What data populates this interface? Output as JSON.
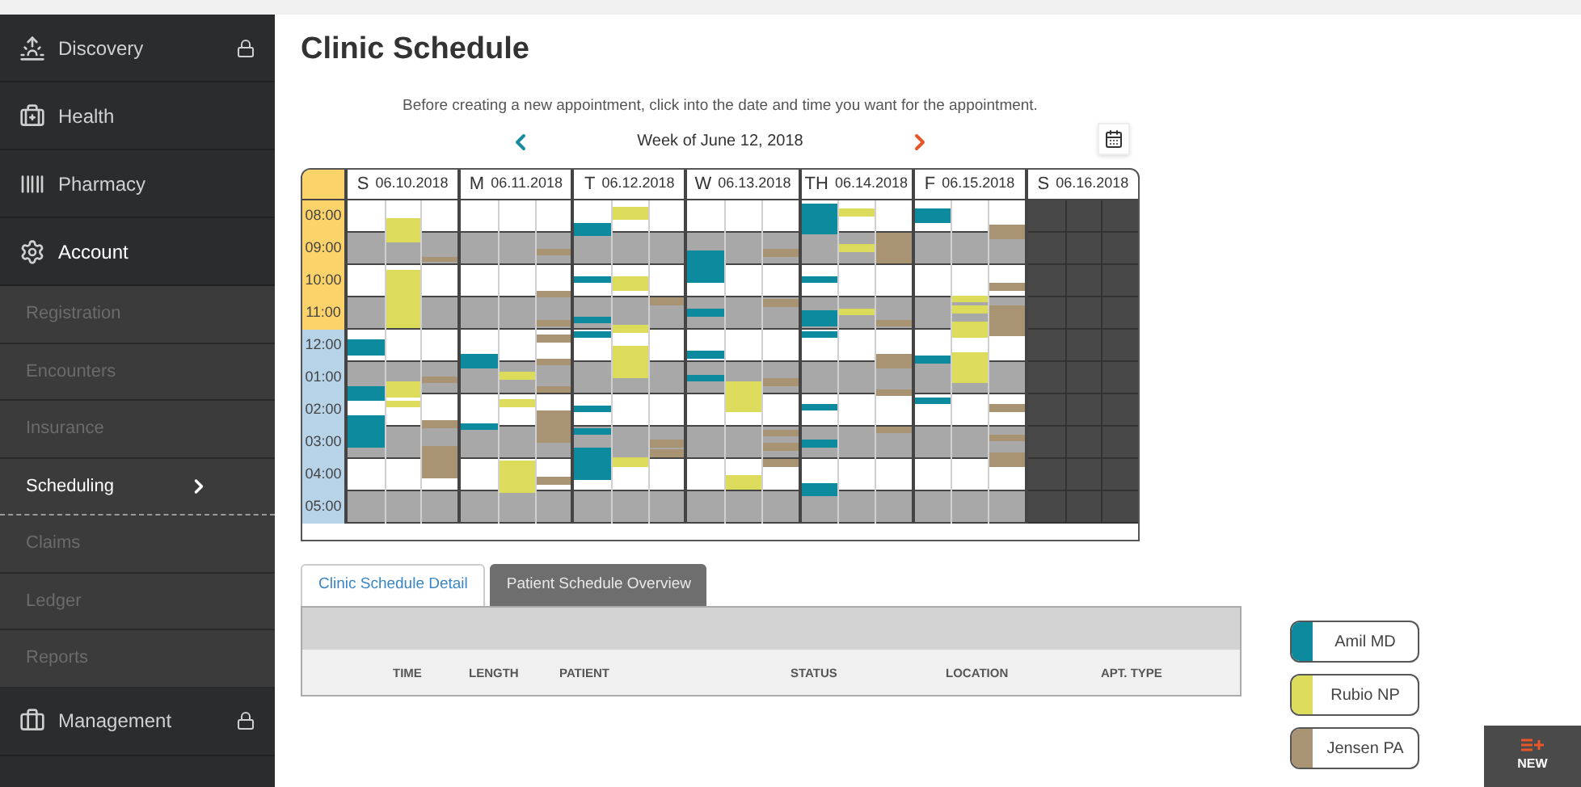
{
  "sidebar": {
    "items": [
      {
        "label": "Discovery",
        "locked": true,
        "expanded": false
      },
      {
        "label": "Health",
        "locked": false,
        "expanded": false
      },
      {
        "label": "Pharmacy",
        "locked": false,
        "expanded": false
      },
      {
        "label": "Account",
        "locked": false,
        "expanded": true,
        "children": [
          {
            "label": "Registration",
            "selected": false
          },
          {
            "label": "Encounters",
            "selected": false
          },
          {
            "label": "Insurance",
            "selected": false
          },
          {
            "label": "Scheduling",
            "selected": true
          },
          {
            "label": "Claims",
            "selected": false
          },
          {
            "label": "Ledger",
            "selected": false
          },
          {
            "label": "Reports",
            "selected": false
          }
        ]
      },
      {
        "label": "Management",
        "locked": true,
        "expanded": false
      }
    ]
  },
  "page": {
    "title": "Clinic Schedule",
    "instruction": "Before creating a new appointment, click into the date and time you want for the appointment.",
    "week": "Week of June 12, 2018"
  },
  "times": [
    {
      "label": "08:00",
      "color": "#fcd36b"
    },
    {
      "label": "09:00",
      "color": "#fcd36b"
    },
    {
      "label": "10:00",
      "color": "#fcd36b"
    },
    {
      "label": "11:00",
      "color": "#fcd36b"
    },
    {
      "label": "12:00",
      "color": "#b7d3e8"
    },
    {
      "label": "01:00",
      "color": "#b7d3e8"
    },
    {
      "label": "02:00",
      "color": "#b7d3e8"
    },
    {
      "label": "03:00",
      "color": "#b7d3e8"
    },
    {
      "label": "04:00",
      "color": "#b7d3e8"
    },
    {
      "label": "05:00",
      "color": "#b7d3e8"
    }
  ],
  "days": [
    {
      "letter": "S",
      "date": "06.10.2018",
      "closed": false
    },
    {
      "letter": "M",
      "date": "06.11.2018",
      "closed": false
    },
    {
      "letter": "T",
      "date": "06.12.2018",
      "closed": false
    },
    {
      "letter": "W",
      "date": "06.13.2018",
      "closed": false
    },
    {
      "letter": "TH",
      "date": "06.14.2018",
      "closed": false
    },
    {
      "letter": "F",
      "date": "06.15.2018",
      "closed": false
    },
    {
      "letter": "S",
      "date": "06.16.2018",
      "closed": true
    }
  ],
  "detail": {
    "tabs": [
      {
        "label": "Clinic Schedule Detail",
        "selected": true
      },
      {
        "label": "Patient Schedule Overview",
        "selected": false
      }
    ],
    "columns": [
      "TIME",
      "LENGTH",
      "PATIENT",
      "STATUS",
      "LOCATION",
      "APT. TYPE"
    ]
  },
  "legend": [
    {
      "label": "Amil MD",
      "color": "#0e8a9e"
    },
    {
      "label": "Rubio NP",
      "color": "#dcdb5c"
    },
    {
      "label": "Jensen PA",
      "color": "#a89373"
    }
  ],
  "new_button": {
    "label": "NEW"
  }
}
